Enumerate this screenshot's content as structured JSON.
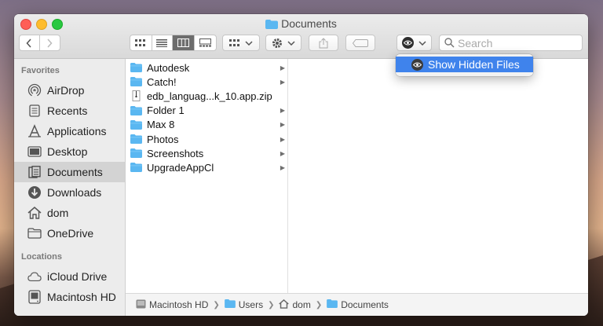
{
  "window": {
    "title": "Documents"
  },
  "toolbar": {
    "search_placeholder": "Search",
    "back_icon": "chevron-left",
    "forward_icon": "chevron-right"
  },
  "menu": {
    "item_label": "Show Hidden Files"
  },
  "sidebar": {
    "favorites_header": "Favorites",
    "favorites": [
      {
        "label": "AirDrop",
        "icon": "airdrop-icon"
      },
      {
        "label": "Recents",
        "icon": "recents-icon"
      },
      {
        "label": "Applications",
        "icon": "applications-icon"
      },
      {
        "label": "Desktop",
        "icon": "desktop-icon"
      },
      {
        "label": "Documents",
        "icon": "documents-icon",
        "selected": true
      },
      {
        "label": "Downloads",
        "icon": "downloads-icon"
      },
      {
        "label": "dom",
        "icon": "home-icon"
      },
      {
        "label": "OneDrive",
        "icon": "folder-icon"
      }
    ],
    "locations_header": "Locations",
    "locations": [
      {
        "label": "iCloud Drive",
        "icon": "cloud-icon"
      },
      {
        "label": "Macintosh HD",
        "icon": "disk-icon"
      }
    ]
  },
  "files": [
    {
      "name": "Autodesk",
      "type": "folder"
    },
    {
      "name": "Catch!",
      "type": "folder"
    },
    {
      "name": "edb_languag...k_10.app.zip",
      "type": "zip"
    },
    {
      "name": "Folder 1",
      "type": "folder"
    },
    {
      "name": "Max 8",
      "type": "folder"
    },
    {
      "name": "Photos",
      "type": "folder"
    },
    {
      "name": "Screenshots",
      "type": "folder"
    },
    {
      "name": "UpgradeAppCl",
      "type": "folder"
    }
  ],
  "pathbar": [
    "Macintosh HD",
    "Users",
    "dom",
    "Documents"
  ],
  "colors": {
    "accent": "#3f83ec",
    "folder": "#5ab7f1"
  }
}
